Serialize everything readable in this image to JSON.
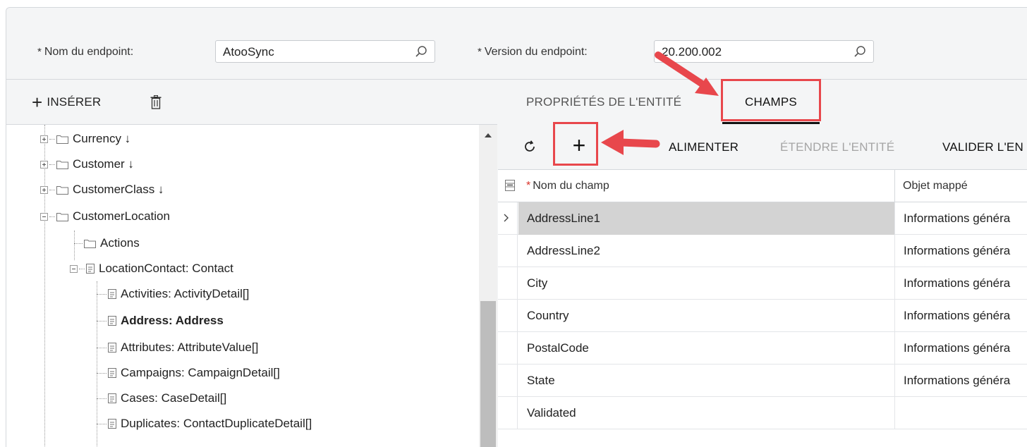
{
  "form": {
    "endpoint_name_label": "Nom du endpoint:",
    "endpoint_name_value": "AtooSync",
    "endpoint_version_label": "Version du endpoint:",
    "endpoint_version_value": "20.200.002",
    "required_marker": "*"
  },
  "left_toolbar": {
    "insert_label": "INSÉRER",
    "insert_icon": "plus-icon",
    "delete_icon": "trash-icon"
  },
  "tree": {
    "nodes": [
      {
        "label": "Currency ↓",
        "icon": "folder-icon",
        "expander": "plus"
      },
      {
        "label": "Customer ↓",
        "icon": "folder-icon",
        "expander": "plus"
      },
      {
        "label": "CustomerClass ↓",
        "icon": "folder-icon",
        "expander": "plus"
      },
      {
        "label": "CustomerLocation",
        "icon": "folder-icon",
        "expander": "minus"
      },
      {
        "label": "Actions",
        "icon": "folder-icon"
      },
      {
        "label": "LocationContact: Contact",
        "icon": "document-icon",
        "expander": "minus"
      },
      {
        "label": "Activities: ActivityDetail[]",
        "icon": "document-icon"
      },
      {
        "label": "Address: Address",
        "icon": "document-icon",
        "selected": true
      },
      {
        "label": "Attributes: AttributeValue[]",
        "icon": "document-icon"
      },
      {
        "label": "Campaigns: CampaignDetail[]",
        "icon": "document-icon"
      },
      {
        "label": "Cases: CaseDetail[]",
        "icon": "document-icon"
      },
      {
        "label": "Duplicates: ContactDuplicateDetail[]",
        "icon": "document-icon"
      }
    ]
  },
  "tabs": [
    {
      "label": "PROPRIÉTÉS DE L'ENTITÉ",
      "active": false
    },
    {
      "label": "CHAMPS",
      "active": true
    }
  ],
  "right_toolbar": {
    "refresh_icon": "refresh-icon",
    "add_label": "+",
    "populate_label": "ALIMENTER",
    "extend_label": "ÉTENDRE L'ENTITÉ",
    "validate_label": "VALIDER L'EN"
  },
  "grid": {
    "columns": [
      "Nom du champ",
      "Objet mappé"
    ],
    "required_marker": "*",
    "rows": [
      {
        "field": "AddressLine1",
        "mapped": "Informations généra"
      },
      {
        "field": "AddressLine2",
        "mapped": "Informations généra"
      },
      {
        "field": "City",
        "mapped": "Informations généra"
      },
      {
        "field": "Country",
        "mapped": "Informations généra"
      },
      {
        "field": "PostalCode",
        "mapped": "Informations généra"
      },
      {
        "field": "State",
        "mapped": "Informations généra"
      },
      {
        "field": "Validated",
        "mapped": ""
      }
    ]
  },
  "colors": {
    "callout": "#e8474c",
    "header_bg": "#f4f5f6",
    "selected_row": "#d3d3d3",
    "required": "#d9342b"
  }
}
